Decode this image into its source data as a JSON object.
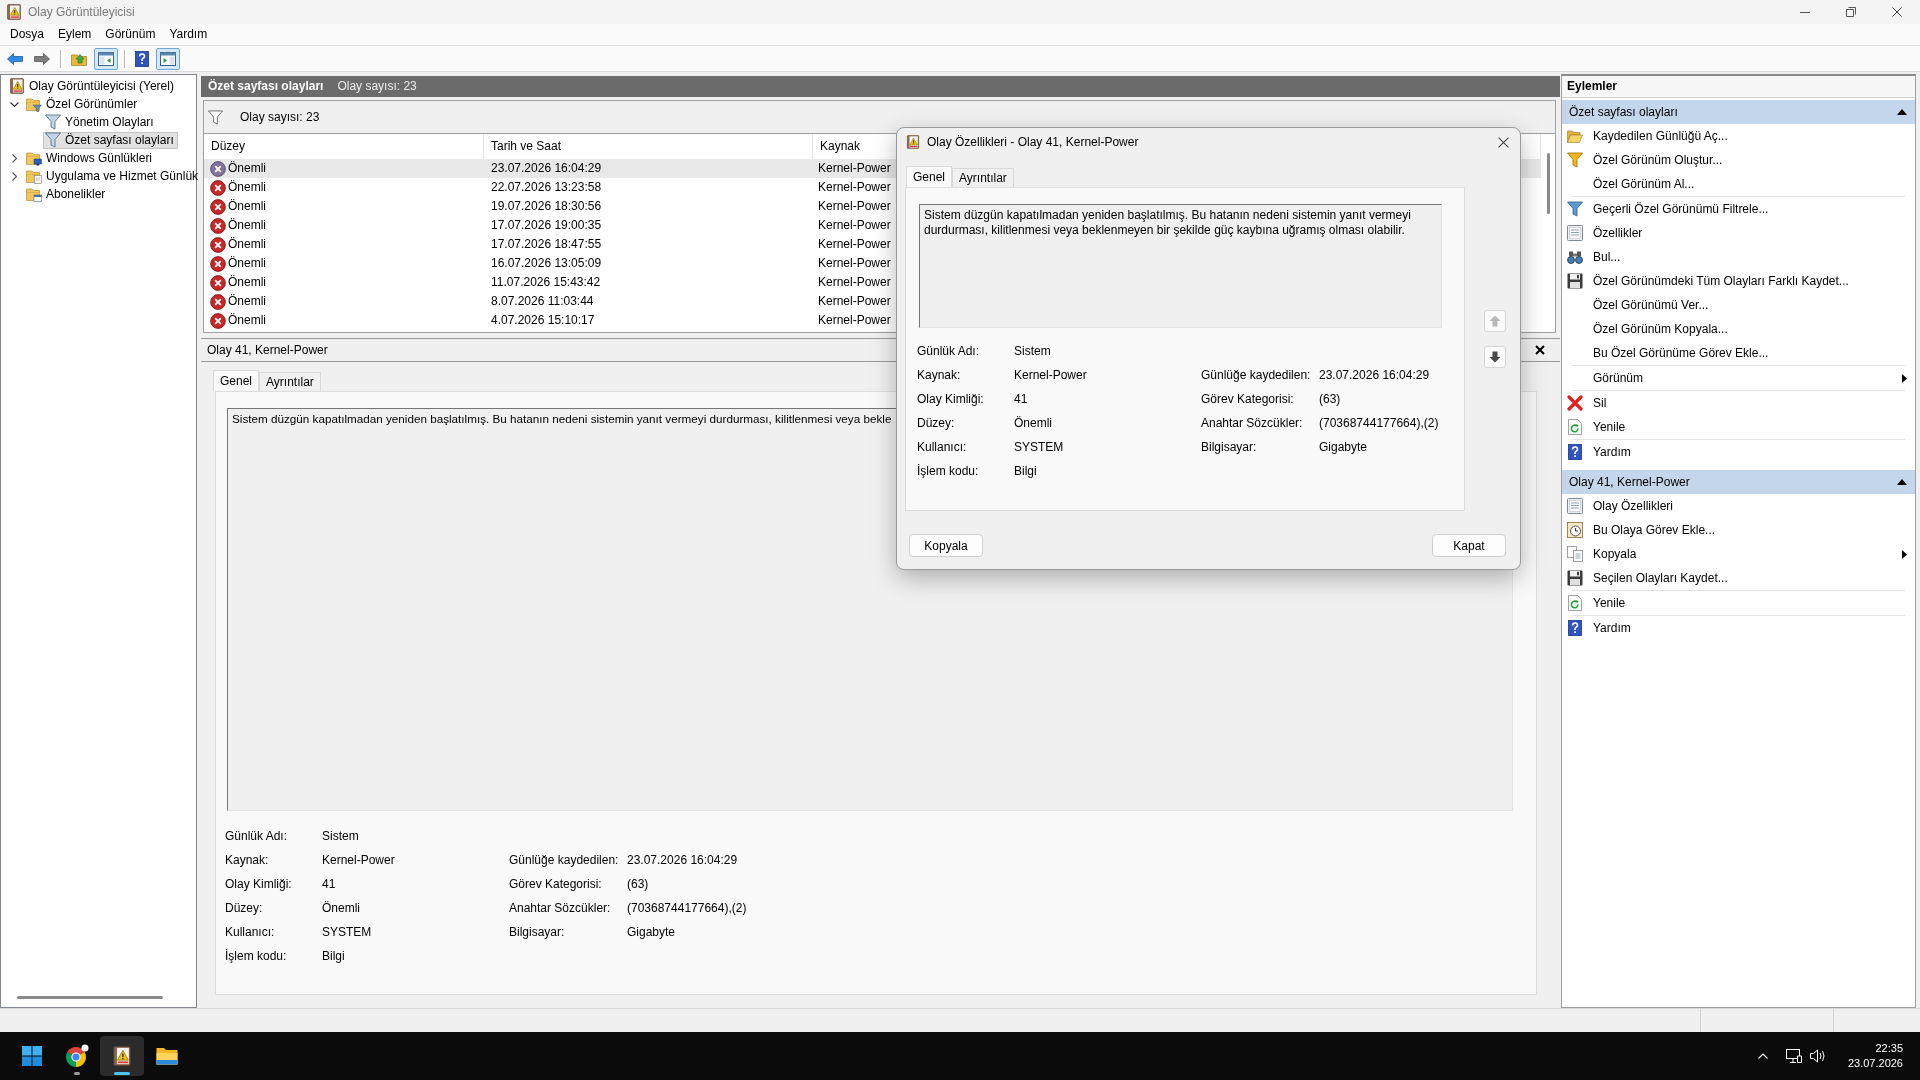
{
  "window": {
    "title": "Olay Görüntüleyicisi"
  },
  "menu": [
    "Dosya",
    "Eylem",
    "Görünüm",
    "Yardım"
  ],
  "toolbar": [
    {
      "kind": "back",
      "on": false,
      "disabled": false
    },
    {
      "kind": "forward",
      "on": false,
      "disabled": true
    },
    {
      "kind": "separator"
    },
    {
      "kind": "up",
      "on": false,
      "disabled": false
    },
    {
      "kind": "console_tree",
      "on": true,
      "disabled": false
    },
    {
      "kind": "separator"
    },
    {
      "kind": "help",
      "on": false,
      "disabled": false
    },
    {
      "kind": "action_pane",
      "on": true,
      "disabled": false
    }
  ],
  "tree": [
    {
      "label": "Olay Görüntüleyicisi (Yerel)",
      "kind": "viewer",
      "selected": false,
      "children": [
        {
          "label": "Özel Görünümler",
          "kind": "custom_views",
          "expanded": true,
          "selected": false,
          "children": [
            {
              "label": "Yönetim Olayları",
              "kind": "filter",
              "selected": false
            },
            {
              "label": "Özet sayfası olayları",
              "kind": "filter",
              "selected": true
            }
          ]
        },
        {
          "label": "Windows Günlükleri",
          "kind": "logs",
          "expanded": false,
          "selected": false
        },
        {
          "label": "Uygulama ve Hizmet Günlük",
          "kind": "app_logs",
          "expanded": false,
          "selected": false
        },
        {
          "label": "Abonelikler",
          "kind": "subscriptions",
          "selected": false
        }
      ]
    }
  ],
  "view_header": {
    "title": "Özet sayfası olayları",
    "count": "Olay sayısı: 23"
  },
  "filter_bar": {
    "text": "Olay sayısı: 23"
  },
  "events_table": {
    "columns": [
      "Düzey",
      "Tarih ve Saat",
      "Kaynak"
    ],
    "rows": [
      {
        "severity": "Önemli",
        "time": "23.07.2026 16:04:29",
        "source": "Kernel-Power",
        "selected": true
      },
      {
        "severity": "Önemli",
        "time": "22.07.2026 13:23:58",
        "source": "Kernel-Power",
        "selected": false
      },
      {
        "severity": "Önemli",
        "time": "19.07.2026 18:30:56",
        "source": "Kernel-Power",
        "selected": false
      },
      {
        "severity": "Önemli",
        "time": "17.07.2026 19:00:35",
        "source": "Kernel-Power",
        "selected": false
      },
      {
        "severity": "Önemli",
        "time": "17.07.2026 18:47:55",
        "source": "Kernel-Power",
        "selected": false
      },
      {
        "severity": "Önemli",
        "time": "16.07.2026 13:05:09",
        "source": "Kernel-Power",
        "selected": false
      },
      {
        "severity": "Önemli",
        "time": "11.07.2026 15:43:42",
        "source": "Kernel-Power",
        "selected": false
      },
      {
        "severity": "Önemli",
        "time": "8.07.2026 11:03:44",
        "source": "Kernel-Power",
        "selected": false
      },
      {
        "severity": "Önemli",
        "time": "4.07.2026 15:10:17",
        "source": "Kernel-Power",
        "selected": false
      }
    ]
  },
  "detail_pane": {
    "title": "Olay 41, Kernel-Power",
    "tabs": [
      {
        "label": "Genel",
        "selected": true
      },
      {
        "label": "Ayrıntılar",
        "selected": false
      }
    ],
    "description": "Sistem düzgün kapatılmadan yeniden başlatılmış. Bu hatanın nedeni sistemin yanıt vermeyi durdurması, kilitlenmesi veya bekle",
    "properties": [
      {
        "left": {
          "label": "Günlük Adı:",
          "value": "Sistem"
        }
      },
      {
        "left": {
          "label": "Kaynak:",
          "value": "Kernel-Power"
        },
        "right": {
          "label": "Günlüğe kaydedilen:",
          "value": "23.07.2026 16:04:29"
        }
      },
      {
        "left": {
          "label": "Olay Kimliği:",
          "value": "41"
        },
        "right": {
          "label": "Görev Kategorisi:",
          "value": "(63)"
        }
      },
      {
        "left": {
          "label": "Düzey:",
          "value": "Önemli"
        },
        "right": {
          "label": "Anahtar Sözcükler:",
          "value": "(70368744177664),(2)"
        }
      },
      {
        "left": {
          "label": "Kullanıcı:",
          "value": "SYSTEM"
        },
        "right": {
          "label": "Bilgisayar:",
          "value": "Gigabyte"
        }
      },
      {
        "left": {
          "label": "İşlem kodu:",
          "value": "Bilgi"
        }
      }
    ]
  },
  "actions": {
    "title": "Eylemler",
    "sections": [
      {
        "title": "Özet sayfası olayları",
        "expanded": true,
        "groups": [
          [
            {
              "label": "Kaydedilen Günlüğü Aç...",
              "kind": "open_folder",
              "submenu": false
            },
            {
              "label": "Özel Görünüm Oluştur...",
              "kind": "new_filter",
              "submenu": false
            },
            {
              "label": "Özel Görünüm Al...",
              "kind": "plain",
              "submenu": false
            }
          ],
          [
            {
              "label": "Geçerli Özel Görünümü Filtrele...",
              "kind": "filter",
              "submenu": false
            },
            {
              "label": "Özellikler",
              "kind": "properties",
              "submenu": false
            },
            {
              "label": "Bul...",
              "kind": "find",
              "submenu": false
            },
            {
              "label": "Özel Görünümdeki Tüm Olayları Farklı Kaydet...",
              "kind": "save",
              "submenu": false
            },
            {
              "label": "Özel Görünümü Ver...",
              "kind": "plain",
              "submenu": false
            },
            {
              "label": "Özel Görünüm Kopyala...",
              "kind": "plain",
              "submenu": false
            },
            {
              "label": "Bu Özel Görünüme Görev Ekle...",
              "kind": "plain",
              "submenu": false
            }
          ],
          [
            {
              "label": "Görünüm",
              "kind": "plain",
              "submenu": true
            }
          ],
          [
            {
              "label": "Sil",
              "kind": "delete",
              "submenu": false
            },
            {
              "label": "Yenile",
              "kind": "refresh",
              "submenu": false
            }
          ],
          [
            {
              "label": "Yardım",
              "kind": "help",
              "submenu": false
            }
          ]
        ]
      },
      {
        "title": "Olay 41, Kernel-Power",
        "expanded": true,
        "groups": [
          [
            {
              "label": "Olay Özellikleri",
              "kind": "properties",
              "submenu": false
            },
            {
              "label": "Bu Olaya Görev Ekle...",
              "kind": "task",
              "submenu": false
            },
            {
              "label": "Kopyala",
              "kind": "copy",
              "submenu": true
            },
            {
              "label": "Seçilen Olayları Kaydet...",
              "kind": "save",
              "submenu": false
            }
          ],
          [
            {
              "label": "Yenile",
              "kind": "refresh",
              "submenu": false
            }
          ],
          [
            {
              "label": "Yardım",
              "kind": "help",
              "submenu": false
            }
          ]
        ]
      }
    ]
  },
  "dialog": {
    "title": "Olay Özellikleri - Olay 41, Kernel-Power",
    "tabs": [
      {
        "label": "Genel",
        "selected": true
      },
      {
        "label": "Ayrıntılar",
        "selected": false
      }
    ],
    "description": "Sistem düzgün kapatılmadan yeniden başlatılmış. Bu hatanın nedeni sistemin yanıt vermeyi durdurması, kilitlenmesi veya beklenmeyen bir şekilde güç kaybına uğramış olması olabilir.",
    "properties": [
      {
        "left": {
          "label": "Günlük Adı:",
          "value": "Sistem"
        }
      },
      {
        "left": {
          "label": "Kaynak:",
          "value": "Kernel-Power"
        },
        "right": {
          "label": "Günlüğe kaydedilen:",
          "value": "23.07.2026 16:04:29"
        }
      },
      {
        "left": {
          "label": "Olay Kimliği:",
          "value": "41"
        },
        "right": {
          "label": "Görev Kategorisi:",
          "value": "(63)"
        }
      },
      {
        "left": {
          "label": "Düzey:",
          "value": "Önemli"
        },
        "right": {
          "label": "Anahtar Sözcükler:",
          "value": "(70368744177664),(2)"
        }
      },
      {
        "left": {
          "label": "Kullanıcı:",
          "value": "SYSTEM"
        },
        "right": {
          "label": "Bilgisayar:",
          "value": "Gigabyte"
        }
      },
      {
        "left": {
          "label": "İşlem kodu:",
          "value": "Bilgi"
        }
      }
    ],
    "navigation": [
      {
        "kind": "previous",
        "disabled": true
      },
      {
        "kind": "next",
        "disabled": false
      }
    ],
    "buttons": [
      "Kopyala",
      "Kapat"
    ]
  },
  "taskbar": {
    "apps": [
      {
        "kind": "start",
        "running": false,
        "active": false
      },
      {
        "kind": "browser",
        "running": true,
        "active": false
      },
      {
        "kind": "event_viewer",
        "running": true,
        "active": true
      },
      {
        "kind": "file_explorer",
        "running": false,
        "active": false
      }
    ],
    "clock": {
      "time": "22:35",
      "date": "23.07.2026"
    }
  }
}
